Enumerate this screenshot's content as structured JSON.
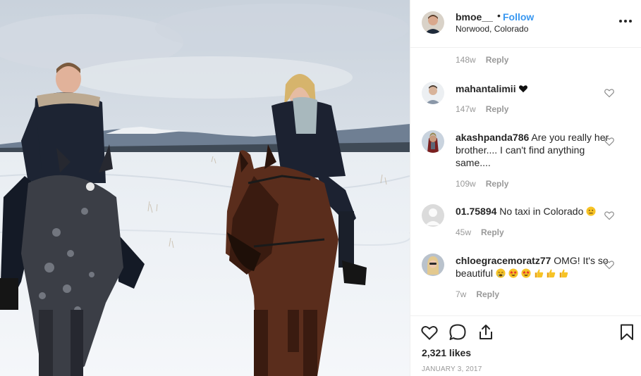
{
  "post": {
    "username": "bmoe__",
    "dot": "•",
    "follow_label": "Follow",
    "location": "Norwood, Colorado",
    "likes": "2,321 likes",
    "date": "JANUARY 3, 2017"
  },
  "top_meta": {
    "age": "148w",
    "reply": "Reply"
  },
  "comments": [
    {
      "user": "mahantalimii",
      "text": "",
      "age": "147w",
      "reply": "Reply"
    },
    {
      "user": "akashpanda786",
      "text": "Are you really her brother.... I can't find anything same....",
      "age": "109w",
      "reply": "Reply"
    },
    {
      "user": "01.75894",
      "text": "No taxi in Colorado",
      "age": "45w",
      "reply": "Reply"
    },
    {
      "user": "chloegracemoratz77",
      "text": "OMG! It's so beautiful",
      "age": "7w",
      "reply": "Reply"
    }
  ],
  "icons": {
    "like": "heart-icon",
    "comment": "comment-icon",
    "share": "share-icon",
    "save": "bookmark-icon",
    "more": "more-options-icon"
  },
  "colors": {
    "accent": "#3897f0",
    "text": "#262626",
    "muted": "#999999",
    "border": "#efefef"
  }
}
